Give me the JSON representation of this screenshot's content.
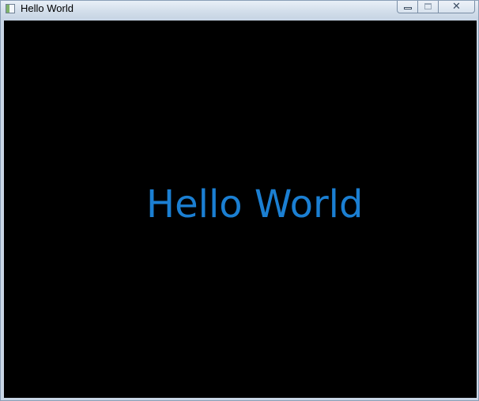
{
  "window": {
    "title": "Hello World",
    "controls": {
      "minimize": "minimize-icon",
      "maximize": "maximize-icon",
      "close": "close-icon"
    }
  },
  "content": {
    "text": "Hello World"
  },
  "colors": {
    "background": "#000000",
    "text": "#1b7fd2"
  }
}
